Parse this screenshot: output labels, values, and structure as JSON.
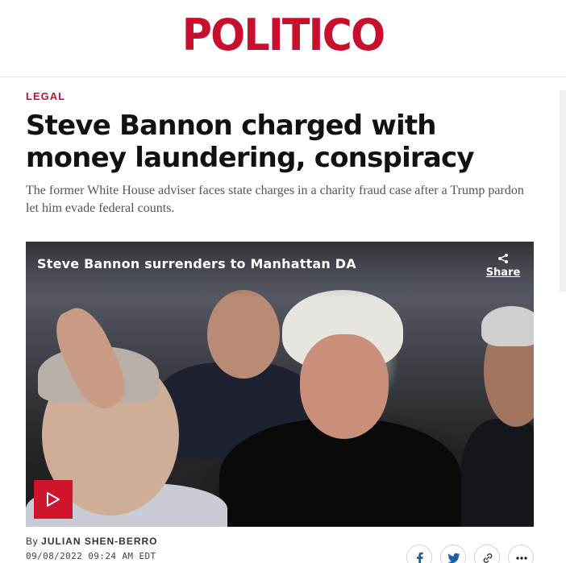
{
  "brand": {
    "logo_text": "POLITICO",
    "accent_color": "#c8102e"
  },
  "article": {
    "category": "LEGAL",
    "headline": "Steve Bannon charged with money laundering, conspiracy",
    "dek": "The former White House adviser faces state charges in a charity fraud case after a Trump pardon let him evade federal counts.",
    "byline_prefix": "By",
    "author": "JULIAN SHEN-BERRO",
    "timestamp": "09/08/2022 09:24 AM EDT"
  },
  "video": {
    "title": "Steve Bannon surrenders to Manhattan DA",
    "share_label": "Share",
    "play_icon": "play-icon",
    "play_color": "#d0142c"
  },
  "social": {
    "icons": [
      "facebook-icon",
      "twitter-icon",
      "link-icon",
      "more-icon"
    ]
  }
}
